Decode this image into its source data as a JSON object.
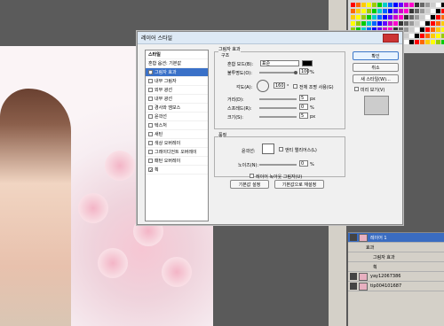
{
  "dialog": {
    "title": "레이어 스타일",
    "styles_header": "스타일",
    "styles": [
      {
        "label": "혼합 옵션: 기본값",
        "checked": false
      },
      {
        "label": "그림자 효과",
        "checked": true,
        "selected": true
      },
      {
        "label": "내부 그림자",
        "checked": false
      },
      {
        "label": "외부 광선",
        "checked": false
      },
      {
        "label": "내부 광선",
        "checked": false
      },
      {
        "label": "경사와 엠보스",
        "checked": false
      },
      {
        "label": "윤곽선",
        "checked": false
      },
      {
        "label": "텍스처",
        "checked": false
      },
      {
        "label": "새틴",
        "checked": false
      },
      {
        "label": "색상 오버레이",
        "checked": false
      },
      {
        "label": "그레이디언트 오버레이",
        "checked": false
      },
      {
        "label": "패턴 오버레이",
        "checked": false
      },
      {
        "label": "획",
        "checked": true
      }
    ],
    "section_title": "그림자 효과",
    "structure_title": "구조",
    "blend_mode_label": "혼합 모드(B):",
    "blend_mode_value": "표준",
    "opacity_label": "불투명도(O):",
    "opacity_value": "100",
    "opacity_unit": "%",
    "angle_label": "각도(A):",
    "angle_value": "160",
    "angle_unit": "°",
    "global_light": "전체 조명 사용(G)",
    "distance_label": "거리(D):",
    "distance_value": "5",
    "distance_unit": "px",
    "spread_label": "스프레드(R):",
    "spread_value": "0",
    "spread_unit": "%",
    "size_label": "크기(S):",
    "size_value": "5",
    "size_unit": "px",
    "quality_title": "품질",
    "contour_label": "윤곽선:",
    "antialias": "앤티 앨리어스(L)",
    "noise_label": "노이즈(N):",
    "noise_value": "0",
    "noise_unit": "%",
    "knockout": "레이어 녹아웃 그림자(U)",
    "make_default": "기본값 설정",
    "reset_default": "기본값으로 재설정",
    "ok": "확인",
    "cancel": "취소",
    "new_style": "새 스타일(W)...",
    "preview": "미리 보기(V)"
  },
  "layers": {
    "items": [
      {
        "name": "레이어 1",
        "selected": true
      },
      {
        "name": "효과",
        "indent": true
      },
      {
        "name": "그림자 효과",
        "indent": true
      },
      {
        "name": "획",
        "indent": true
      },
      {
        "name": "yay12067386"
      },
      {
        "name": "tip004101687"
      }
    ]
  }
}
